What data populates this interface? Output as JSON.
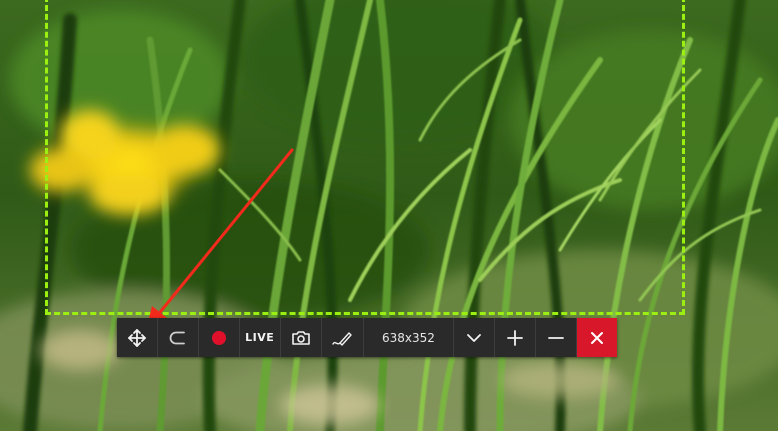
{
  "toolbar": {
    "live_label": "LIVE",
    "size_label": "638x352"
  },
  "icons": {
    "move": "move-icon",
    "loop": "loop-icon",
    "record": "record-icon",
    "camera": "camera-icon",
    "pen": "pen-icon",
    "chevron": "chevron-down-icon",
    "plus": "plus-icon",
    "minus": "minus-icon",
    "close": "close-icon"
  },
  "colors": {
    "selection_border": "#9bf011",
    "toolbar_bg": "#2a2a2a",
    "record": "#e0102a",
    "close_bg": "#d9172b",
    "annotation_arrow": "#f22a1c"
  }
}
